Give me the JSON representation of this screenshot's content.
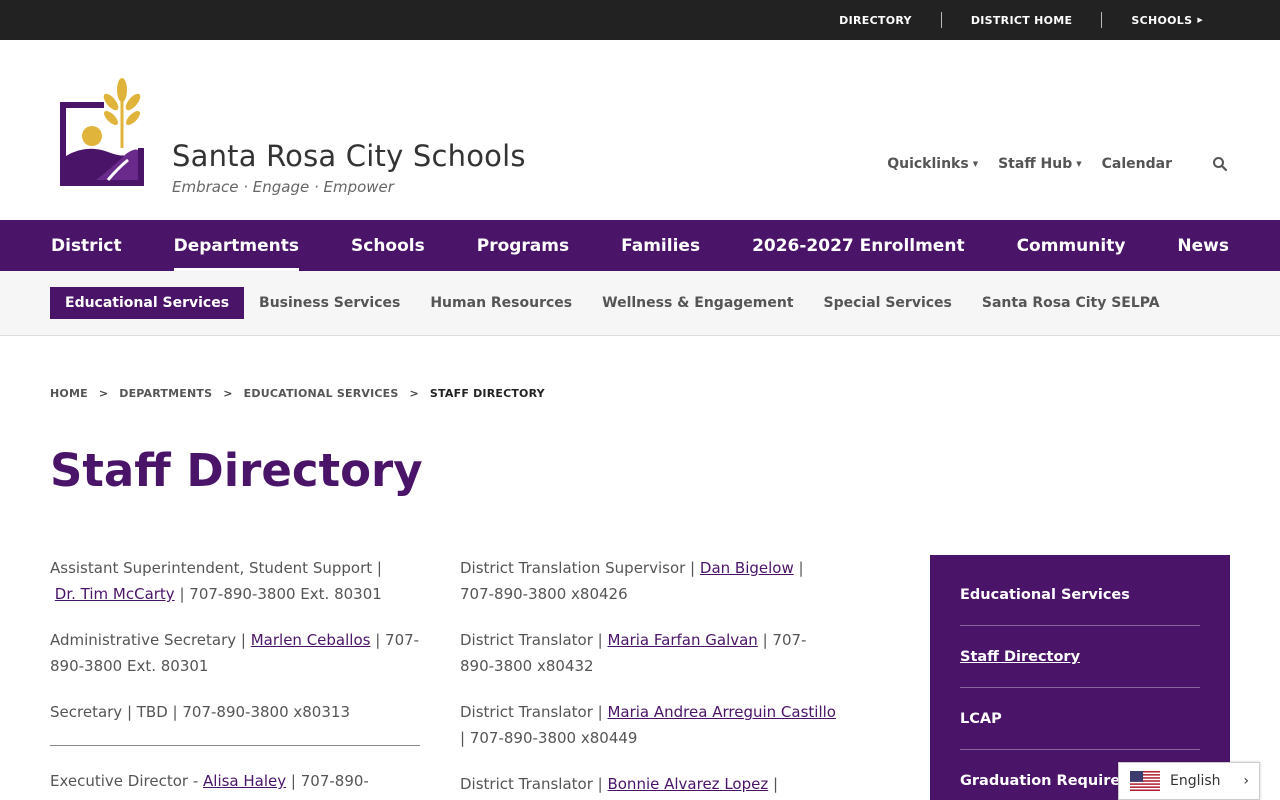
{
  "utility": {
    "directory": "DIRECTORY",
    "district_home": "DISTRICT HOME",
    "schools": "SCHOOLS"
  },
  "brand": {
    "title": "Santa Rosa City Schools",
    "tagline": "Embrace · Engage · Empower",
    "colors": {
      "purple": "#4a1468",
      "gold": "#e0b43a"
    }
  },
  "header_links": {
    "quicklinks": "Quicklinks",
    "staff_hub": "Staff Hub",
    "calendar": "Calendar"
  },
  "main_nav": [
    "District",
    "Departments",
    "Schools",
    "Programs",
    "Families",
    "2026-2027 Enrollment",
    "Community",
    "News"
  ],
  "sub_nav": [
    "Educational Services",
    "Business Services",
    "Human Resources",
    "Wellness & Engagement",
    "Special Services",
    "Santa Rosa City SELPA"
  ],
  "breadcrumb": [
    "HOME",
    "DEPARTMENTS",
    "EDUCATIONAL SERVICES",
    "STAFF DIRECTORY"
  ],
  "page_title": "Staff Directory",
  "col1": {
    "e1_role": "Assistant Superintendent, Student Support |",
    "e1_name": "Dr. Tim McCarty",
    "e1_phone": " | 707-890-3800 Ext. 80301",
    "e2_role": "Administrative Secretary | ",
    "e2_name": "Marlen Ceballos",
    "e2_phone": "  | 707-890-3800 Ext. 80301",
    "e3_text": "Secretary | TBD  | 707-890-3800 x80313",
    "e4_role": "Executive Director - ",
    "e4_name": "Alisa Haley",
    "e4_phone": " | 707-890-"
  },
  "col2": {
    "e1_role": "District Translation Supervisor | ",
    "e1_name": "Dan Bigelow",
    "e1_phone": " | 707-890-3800 x80426",
    "e2_role": "District Translator | ",
    "e2_name": "Maria Farfan Galvan",
    "e2_phone": " |  707-890-3800 x80432",
    "e3_role": "District Translator | ",
    "e3_name": "Maria Andrea Arreguin Castillo",
    "e3_phone": " | 707-890-3800 x80449",
    "e4_role": "District Translator | ",
    "e4_name": "Bonnie Alvarez Lopez",
    "e4_phone": " |"
  },
  "sidebar": [
    "Educational Services",
    "Staff Directory",
    "LCAP",
    "Graduation Requirements"
  ],
  "language": {
    "label": "English"
  }
}
